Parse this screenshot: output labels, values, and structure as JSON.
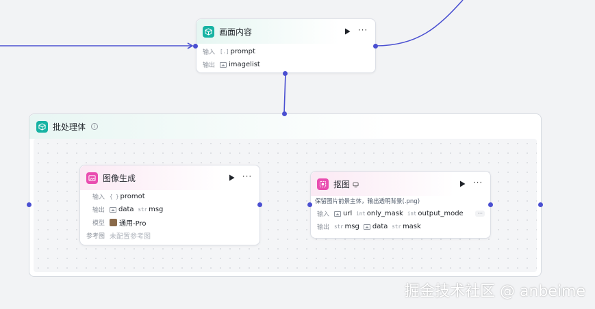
{
  "labels": {
    "input": "输入",
    "output": "输出",
    "model": "模型",
    "reference": "参考图"
  },
  "colors": {
    "edge": "#4a4fd1",
    "teal_icon": "#17b3a3",
    "pink_icon": "#e94db0"
  },
  "node_content": {
    "title": "画面内容",
    "inputs": [
      {
        "tag": "[.]",
        "name": "prompt"
      }
    ],
    "outputs": [
      {
        "tag": "image-list-icon",
        "name": "imagelist"
      }
    ]
  },
  "group_batch": {
    "title": "批处理体",
    "info_icon": "info-icon"
  },
  "node_image_gen": {
    "title": "图像生成",
    "inputs": [
      {
        "tag": "{ }",
        "name": "promot"
      }
    ],
    "outputs": [
      {
        "tag": "image-icon",
        "name": "data"
      },
      {
        "tag": "str",
        "name": "msg"
      }
    ],
    "model": "通用-Pro",
    "reference": "未配置参考图"
  },
  "node_cutout": {
    "title": "抠图",
    "badge_icon": "model-badge-icon",
    "description": "保留图片前景主体，输出透明背景(.png)",
    "inputs": [
      {
        "tag": "image-icon",
        "name": "url"
      },
      {
        "tag": "int",
        "name": "only_mask"
      },
      {
        "tag": "int",
        "name": "output_mode"
      }
    ],
    "inputs_more": "···",
    "outputs": [
      {
        "tag": "str",
        "name": "msg"
      },
      {
        "tag": "image-icon",
        "name": "data"
      },
      {
        "tag": "str",
        "name": "mask"
      }
    ]
  },
  "more_label": "···",
  "watermark": "掘金技术社区 @ anbeime"
}
